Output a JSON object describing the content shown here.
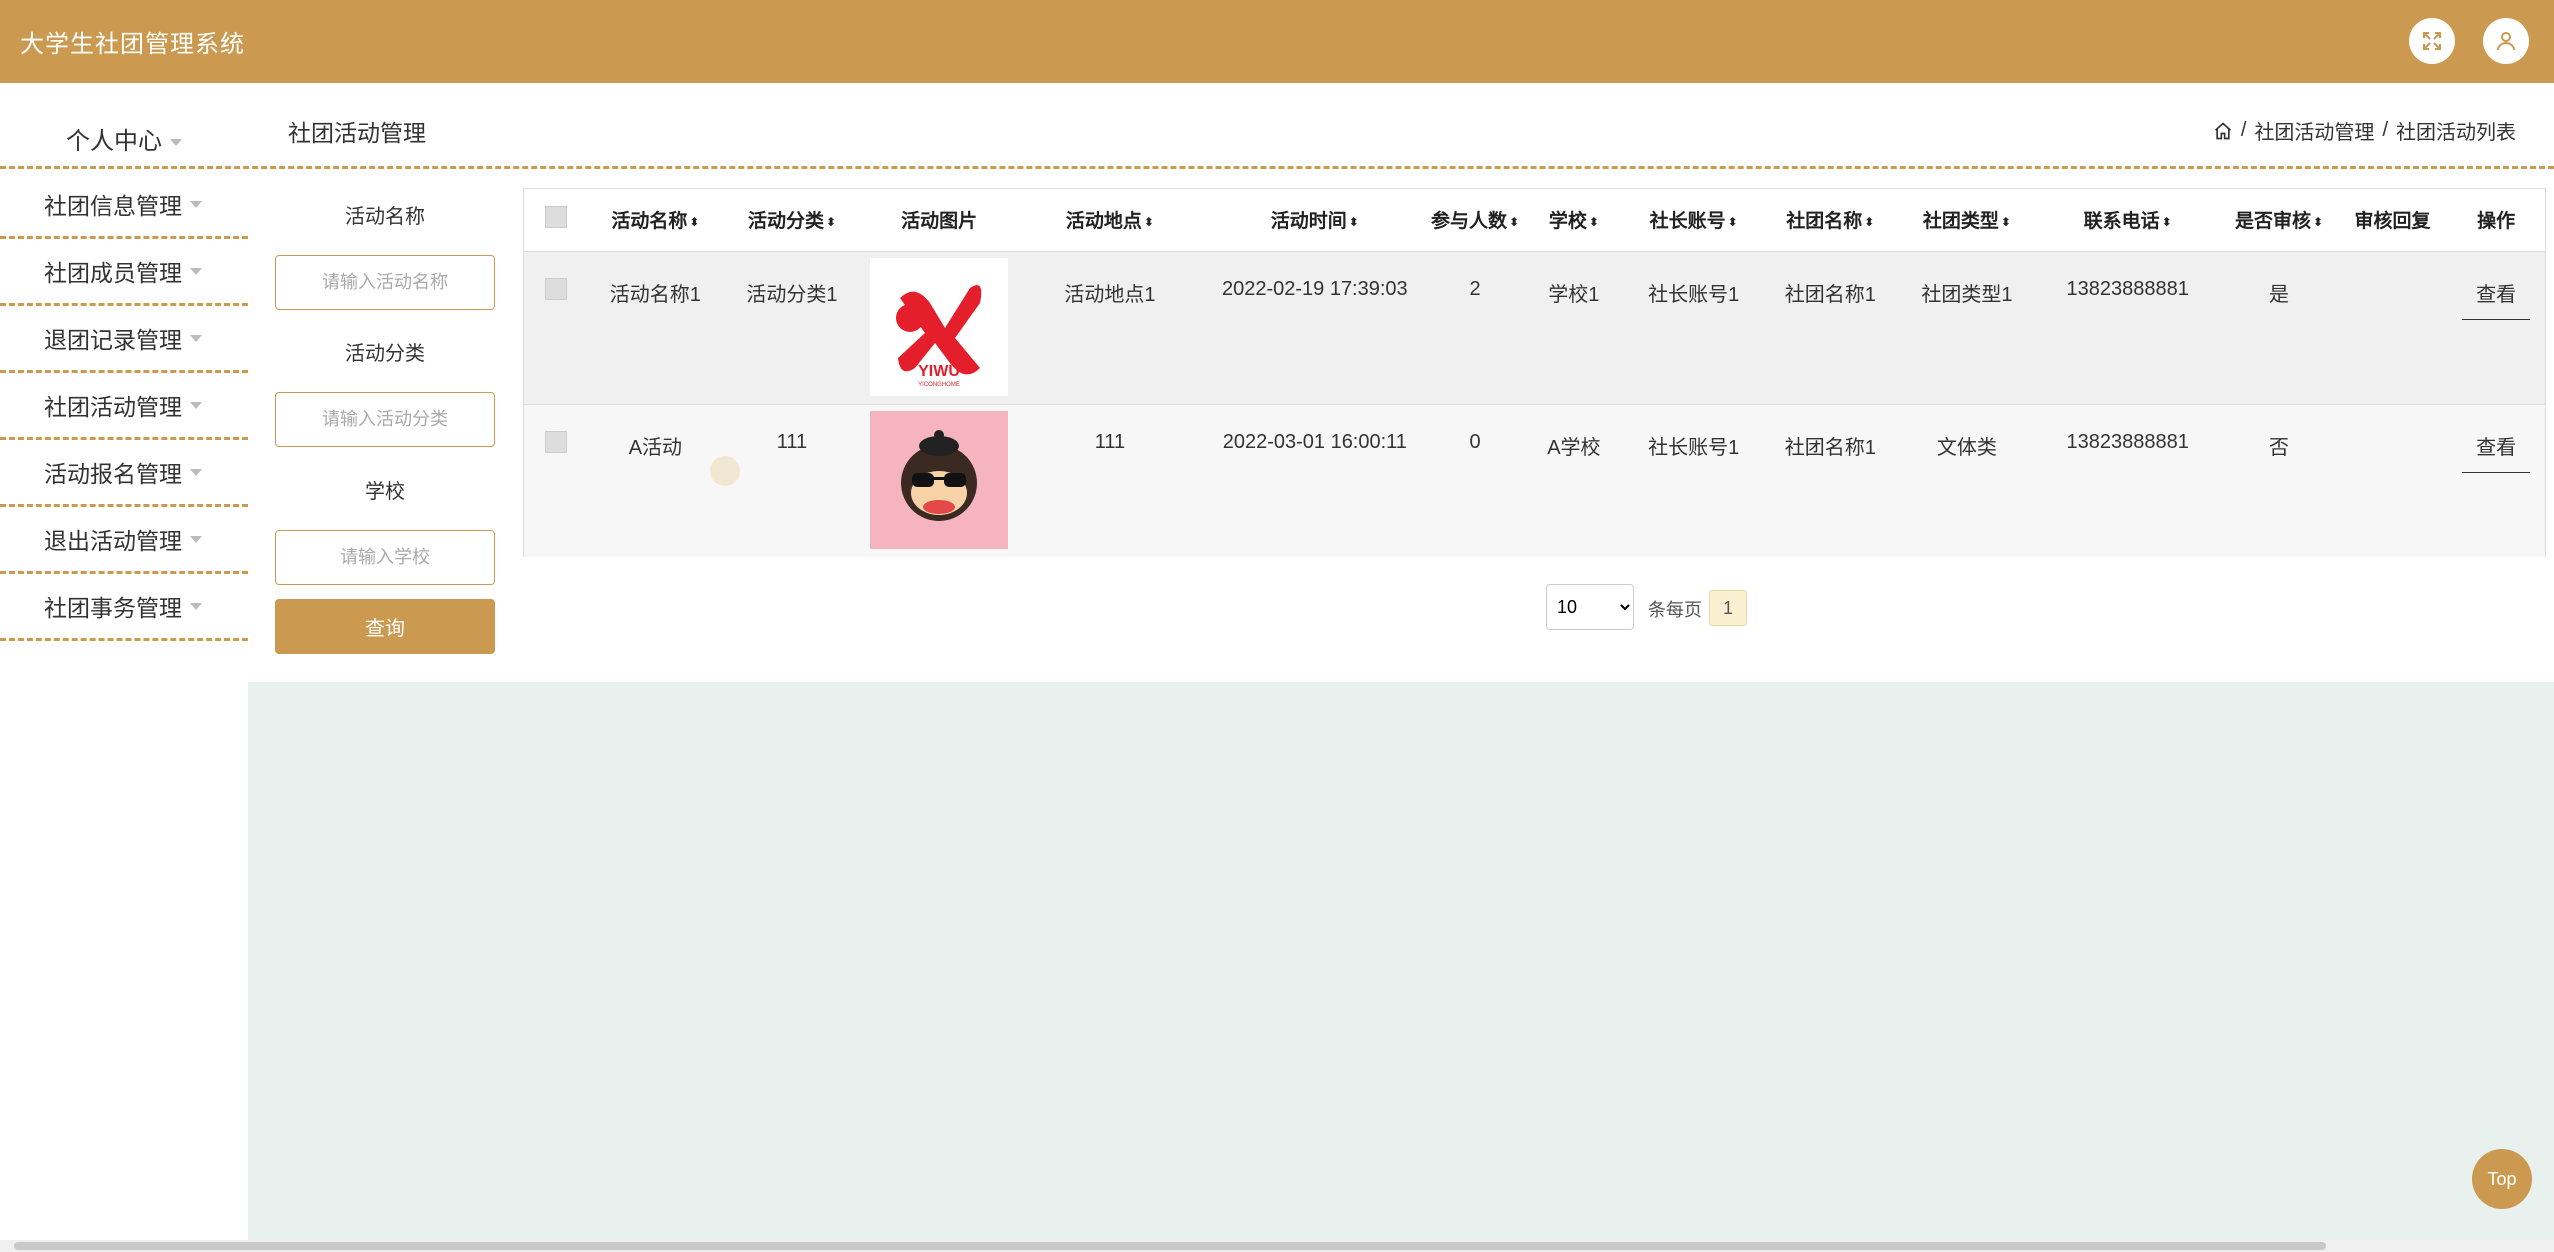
{
  "app": {
    "title": "大学生社团管理系统"
  },
  "topbar": {
    "fullscreen_icon": "fullscreen-icon",
    "user_icon": "user-icon"
  },
  "sidebar": {
    "head": "个人中心",
    "items": [
      {
        "label": "社团信息管理"
      },
      {
        "label": "社团成员管理"
      },
      {
        "label": "退团记录管理"
      },
      {
        "label": "社团活动管理"
      },
      {
        "label": "活动报名管理"
      },
      {
        "label": "退出活动管理"
      },
      {
        "label": "社团事务管理"
      }
    ]
  },
  "page": {
    "title": "社团活动管理"
  },
  "breadcrumb": {
    "home_icon": "home-icon",
    "sep": "/",
    "items": [
      "社团活动管理",
      "社团活动列表"
    ]
  },
  "search": {
    "fields": [
      {
        "label": "活动名称",
        "placeholder": "请输入活动名称"
      },
      {
        "label": "活动分类",
        "placeholder": "请输入活动分类"
      },
      {
        "label": "学校",
        "placeholder": "请输入学校"
      }
    ],
    "button": "查询"
  },
  "table": {
    "headers": [
      "活动名称",
      "活动分类",
      "活动图片",
      "活动地点",
      "活动时间",
      "参与人数",
      "学校",
      "社长账号",
      "社团名称",
      "社团类型",
      "联系电话",
      "是否审核",
      "审核回复",
      "操作"
    ],
    "rows": [
      {
        "name": "活动名称1",
        "category": "活动分类1",
        "image": "yiwu-logo",
        "location": "活动地点1",
        "time": "2022-02-19 17:39:03",
        "count": "2",
        "school": "学校1",
        "leader": "社长账号1",
        "club": "社团名称1",
        "club_type": "社团类型1",
        "phone": "13823888881",
        "audited": "是",
        "reply": "",
        "action": "查看"
      },
      {
        "name": "A活动",
        "category": "111",
        "image": "monkey-cartoon",
        "location": "111",
        "time": "2022-03-01 16:00:11",
        "count": "0",
        "school": "A学校",
        "leader": "社长账号1",
        "club": "社团名称1",
        "club_type": "文体类",
        "phone": "13823888881",
        "audited": "否",
        "reply": "",
        "action": "查看"
      }
    ]
  },
  "pagination": {
    "page_size": "10",
    "per_page_label": "条每页",
    "current_page": "1"
  },
  "back_to_top": "Top",
  "image_text": {
    "logo_main": "YIWU",
    "logo_sub": "YICONGHOME"
  },
  "colors": {
    "accent": "#cb9a50",
    "footer_bg": "#e8f1ed",
    "page_highlight": "#faf0cf"
  }
}
